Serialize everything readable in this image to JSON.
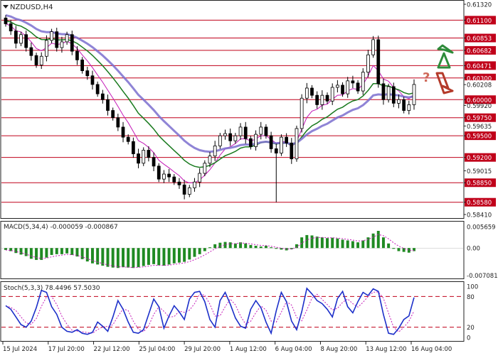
{
  "colors": {
    "background": "#ffffff",
    "frame": "#222222",
    "grid_grey": "#9e9e9e",
    "level_red": "#c0001a",
    "bull_candle": "#ffffff",
    "bear_candle": "#000000",
    "ma_fast": "#c41ab8",
    "ma_mid": "#197a1e",
    "ma_slow": "#7b6fcf",
    "macd_hist": "#1f8a22",
    "macd_signal": "#c41ab8",
    "stoch_main": "#1c2fc9",
    "stoch_signal": "#c41ab8",
    "stoch_level": "#c0001a",
    "arrow_up": "#2e8b3a",
    "arrow_down": "#b43a2a",
    "question": "#cf6a5a"
  },
  "icons": {
    "dropdown": "triangle-down-icon",
    "up": "up-arrow-icon",
    "down": "down-arrow-icon"
  },
  "chart_data": [
    {
      "type": "candlestick",
      "title": "NZDUSD,H4",
      "ylim": [
        0.5841,
        0.6132
      ],
      "y_ticks": [
        "0.61320",
        "0.61100",
        "0.60853",
        "0.60682",
        "0.60471",
        "0.60300",
        "0.60208",
        "0.60000",
        "0.59920",
        "0.59750",
        "0.59635",
        "0.59500",
        "0.59200",
        "0.59015",
        "0.58850",
        "0.58580",
        "0.58410"
      ],
      "level_labels": [
        "0.61100",
        "0.60853",
        "0.60682",
        "0.60471",
        "0.60300",
        "0.60000",
        "0.59750",
        "0.59500",
        "0.59200",
        "0.58850",
        "0.58580"
      ],
      "levels": [
        0.611,
        0.60853,
        0.60682,
        0.60471,
        0.603,
        0.6,
        0.5975,
        0.595,
        0.592,
        0.5885,
        0.5858
      ],
      "current_price": "0.60208",
      "annotation": "?",
      "close_series": [
        0.6105,
        0.6095,
        0.6078,
        0.609,
        0.6072,
        0.6061,
        0.6048,
        0.606,
        0.6082,
        0.6094,
        0.6072,
        0.608,
        0.609,
        0.6067,
        0.6055,
        0.604,
        0.6033,
        0.6021,
        0.6008,
        0.6,
        0.5985,
        0.5975,
        0.5962,
        0.5948,
        0.5942,
        0.5925,
        0.5912,
        0.593,
        0.592,
        0.5908,
        0.589,
        0.5897,
        0.5893,
        0.5886,
        0.5882,
        0.5869,
        0.5878,
        0.5886,
        0.5898,
        0.5912,
        0.5922,
        0.5936,
        0.595,
        0.5953,
        0.5943,
        0.595,
        0.5962,
        0.5946,
        0.5935,
        0.5952,
        0.5962,
        0.595,
        0.5932,
        0.5926,
        0.5948,
        0.594,
        0.5918,
        0.596,
        0.6002,
        0.6016,
        0.6006,
        0.5993,
        0.6006,
        0.5998,
        0.6017,
        0.602,
        0.6008,
        0.6026,
        0.6023,
        0.6012,
        0.6038,
        0.6062,
        0.6083,
        0.6022,
        0.6,
        0.6018,
        0.5995,
        0.6,
        0.5985,
        0.5993,
        0.6021
      ],
      "open_close_high_low_note": "",
      "series": [
        {
          "name": "",
          "role": "ma_fast"
        },
        {
          "name": "",
          "role": "ma_mid"
        },
        {
          "name": "",
          "role": "ma_slow"
        }
      ]
    },
    {
      "type": "bar",
      "title": "MACD(5,34,4) -0.000059 -0.000867",
      "ylim": [
        -0.0072,
        0.0058
      ],
      "y_ticks": [
        "0.005659",
        "0.00",
        "-0.007081"
      ],
      "values": [
        -0.0005,
        -0.0008,
        -0.0013,
        -0.0017,
        -0.0021,
        -0.0028,
        -0.0031,
        -0.0031,
        -0.0025,
        -0.0018,
        -0.0016,
        -0.0016,
        -0.0014,
        -0.0018,
        -0.0022,
        -0.0029,
        -0.0035,
        -0.004,
        -0.0043,
        -0.0046,
        -0.0049,
        -0.0051,
        -0.0052,
        -0.005,
        -0.0051,
        -0.0052,
        -0.005,
        -0.0047,
        -0.0044,
        -0.0042,
        -0.0045,
        -0.0046,
        -0.0043,
        -0.004,
        -0.0038,
        -0.0036,
        -0.003,
        -0.0023,
        -0.0016,
        -0.0008,
        0.0002,
        0.001,
        0.0014,
        0.0016,
        0.0015,
        0.0012,
        0.0015,
        0.0012,
        0.0008,
        0.0006,
        0.0004,
        0.0006,
        0.0002,
        -0.0002,
        -0.0004,
        -0.0006,
        -0.0003,
        0.001,
        0.0028,
        0.0034,
        0.0033,
        0.003,
        0.0028,
        0.0026,
        0.0027,
        0.0025,
        0.0022,
        0.002,
        0.0018,
        0.0015,
        0.002,
        0.0028,
        0.0038,
        0.0045,
        0.0028,
        0.0012,
        -0.0002,
        -0.0008,
        -0.001,
        -0.0012,
        -0.0008
      ]
    },
    {
      "type": "line",
      "title": "Stoch(5,3,3) 78.4496 57.5030",
      "ylim": [
        0,
        100
      ],
      "y_ticks": [
        "100",
        "80",
        "20",
        "0"
      ],
      "levels": [
        80,
        20
      ],
      "series": [
        {
          "name": "",
          "values": [
            62,
            55,
            40,
            25,
            20,
            32,
            58,
            92,
            88,
            60,
            45,
            20,
            12,
            10,
            15,
            8,
            6,
            10,
            30,
            22,
            12,
            40,
            72,
            55,
            30,
            10,
            8,
            15,
            45,
            75,
            60,
            18,
            42,
            62,
            50,
            35,
            75,
            88,
            90,
            70,
            35,
            20,
            72,
            88,
            65,
            38,
            22,
            18,
            55,
            72,
            58,
            30,
            8,
            52,
            88,
            70,
            32,
            15,
            50,
            96,
            85,
            72,
            66,
            55,
            40,
            76,
            90,
            60,
            48,
            70,
            88,
            82,
            95,
            90,
            45,
            8,
            6,
            18,
            35,
            42,
            78
          ]
        }
      ]
    }
  ],
  "x_axis_labels": [
    "15 Jul 2024",
    "17 Jul 20:00",
    "22 Jul 12:00",
    "25 Jul 04:00",
    "29 Jul 20:00",
    "1 Aug 12:00",
    "6 Aug 04:00",
    "8 Aug 20:00",
    "13 Aug 12:00",
    "16 Aug 04:00"
  ]
}
